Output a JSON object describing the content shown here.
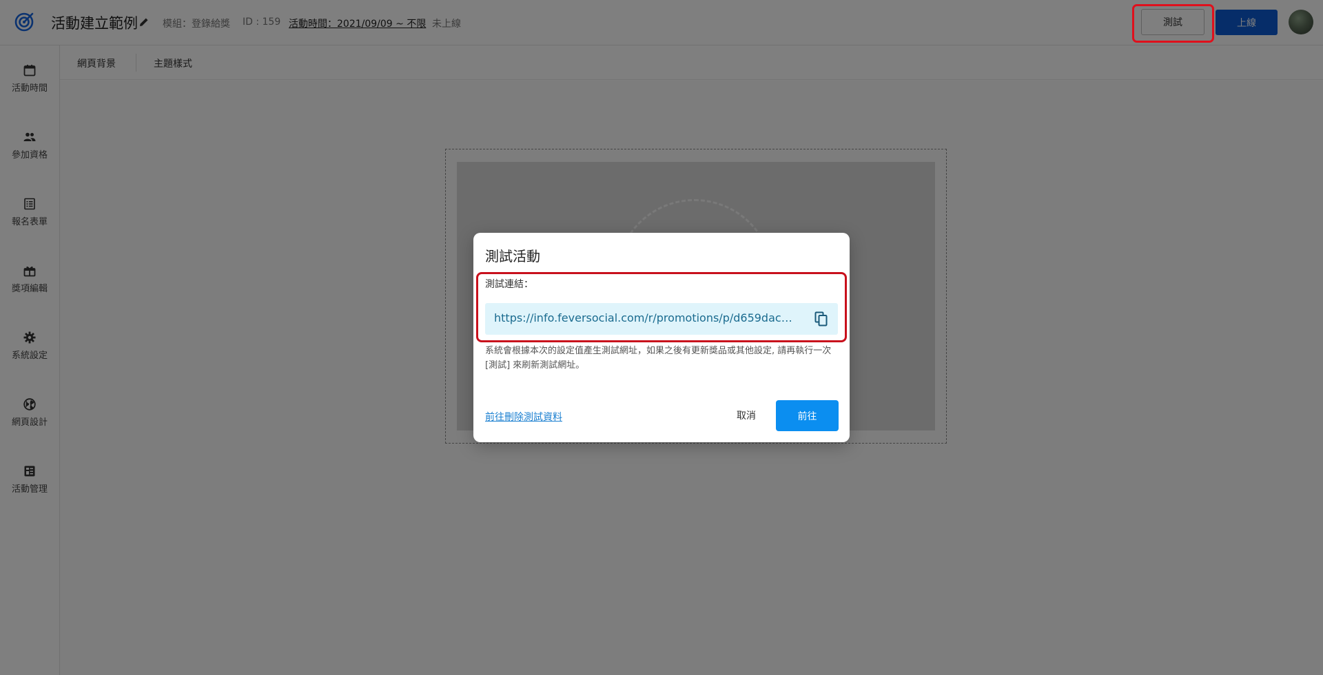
{
  "header": {
    "title": "活動建立範例",
    "module": "模組：登錄給獎",
    "id": "ID : 159",
    "time": "活動時間：2021/09/09 ~ 不限",
    "status": "未上線",
    "test_label": "測試",
    "online_label": "上線"
  },
  "sidebar": {
    "items": [
      {
        "label": "活動時間",
        "icon": "calendar-icon"
      },
      {
        "label": "參加資格",
        "icon": "people-icon"
      },
      {
        "label": "報名表單",
        "icon": "form-icon"
      },
      {
        "label": "獎項編輯",
        "icon": "gift-icon"
      },
      {
        "label": "系統設定",
        "icon": "gear-icon"
      },
      {
        "label": "網頁設計",
        "icon": "globe-icon"
      },
      {
        "label": "活動管理",
        "icon": "dashboard-icon"
      }
    ]
  },
  "tabs": {
    "background": "網頁背景",
    "theme": "主題樣式"
  },
  "dialog": {
    "title": "測試活動",
    "link_label": "測試連結：",
    "link_url": "https://info.feversocial.com/r/promotions/p/d659dac…",
    "note": "系統會根據本次的設定值產生測試網址，如果之後有更新獎品或其他設定, 請再執行一次 [測試] 來刷新測試網址。",
    "delete_link": "前往刪除測試資料",
    "cancel_label": "取消",
    "go_label": "前往"
  },
  "colors": {
    "primary": "#0b8ef0",
    "online_button": "#0d5bd3",
    "highlight": "#e0101c",
    "link_bg": "#dff4fb"
  }
}
